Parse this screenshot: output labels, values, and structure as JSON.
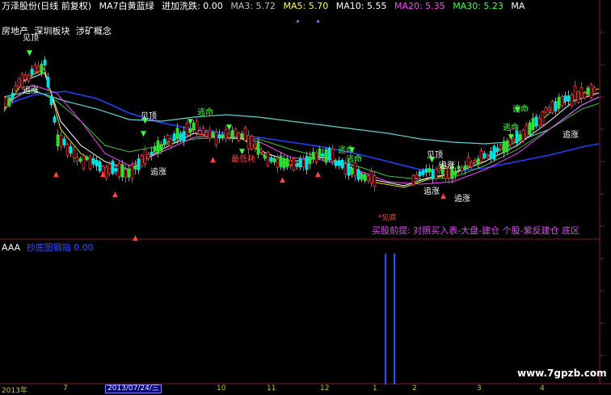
{
  "header": {
    "stock": "万泽股份(日线 前复权)",
    "ma7_label": "MA7白黄蓝绿",
    "entry_label": "进加洗跌: 0.00",
    "ma3": "MA3: 5.72",
    "ma5": "MA5: 5.70",
    "ma10": "MA10: 5.55",
    "ma20": "MA20: 5.35",
    "ma30": "MA30: 5.23",
    "ma_tail": "MA"
  },
  "tags": [
    "房地产",
    "深圳板块",
    "涉矿概念"
  ],
  "annotations": {
    "top_left": "见顶",
    "left_mid": "追涨",
    "mid_top": "见顶",
    "mid_escape": "逃命",
    "mid_chase": "追涨",
    "mid_low": "最低耗",
    "right_a": "逃命",
    "right_b": "逃命",
    "right_c": "见顶",
    "right_chase1": "追涨",
    "right_chase2": "追涨",
    "far_right_escape1": "逃命",
    "far_right_escape2": "逃命",
    "far_right_chase": "追涨"
  },
  "small_red": "*见底",
  "note": "买股前提: 对照买入表-大盘-建仓  个股-紫反建仓 底区",
  "sub": {
    "name": "AAA",
    "indicator": "抄底图钢指  0.00"
  },
  "axis": {
    "labels": [
      "2013年",
      "7",
      "2013/07/24/三",
      "10",
      "11",
      "12",
      "1",
      "2",
      "3",
      "4"
    ]
  },
  "watermark": "www.7gpzb.com",
  "colors": {
    "up": "#ff3030",
    "down": "#00e0e0",
    "up_fill": "#ff3030",
    "green_bar": "#33dd33",
    "blue_line": "#2040ff",
    "ma_white": "#ffffff",
    "ma_yellow": "#e6e600",
    "ma_magenta": "#ff40ff",
    "ma_green": "#40c040",
    "ma_cyan": "#60d0d0"
  }
}
